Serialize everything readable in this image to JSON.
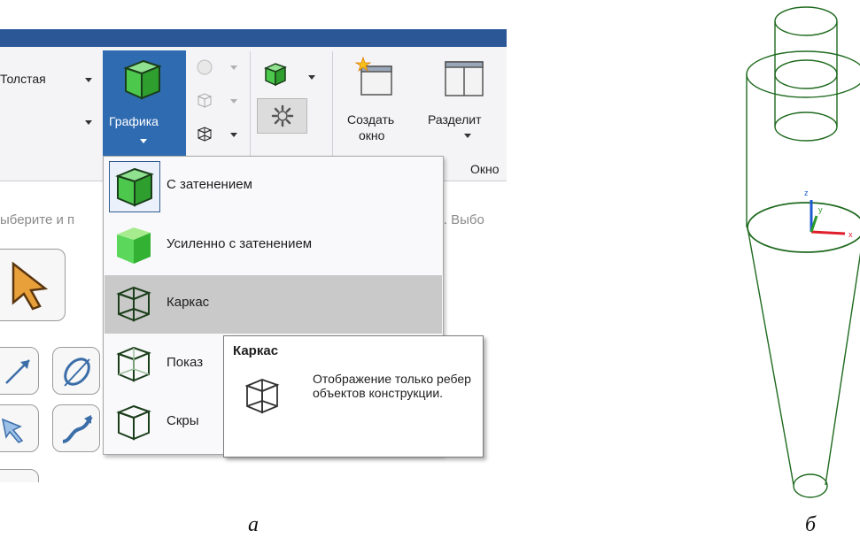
{
  "ribbon": {
    "line_label": "Толстая",
    "grafika_label": "Графика",
    "create_window_label_line1": "Создать",
    "create_window_label_line2": "окно",
    "split_label": "Разделит",
    "window_group_label": "Окно"
  },
  "status": {
    "prompt_left": "ыберите и п",
    "prompt_right": "ь. Выбо"
  },
  "dropdown": {
    "items": [
      {
        "label": "С затенением",
        "icon": "shaded-cube-icon"
      },
      {
        "label": "Усиленно с затенением",
        "icon": "enhanced-shaded-cube-icon"
      },
      {
        "label": "Каркас",
        "icon": "wireframe-cube-icon"
      },
      {
        "label": "Показ",
        "icon": "hidden-lines-visible-icon"
      },
      {
        "label": "Скры",
        "icon": "hidden-lines-removed-icon"
      }
    ]
  },
  "tooltip": {
    "title": "Каркас",
    "description": "Отображение только ребер объектов конструкции."
  },
  "model": {
    "axis_x": "x",
    "axis_y": "y",
    "axis_z": "z",
    "line_color": "#1f6a1f"
  },
  "captions": {
    "left": "а",
    "right": "б"
  },
  "colors": {
    "accent": "#2f6bb1",
    "titlebar": "#2b5797",
    "shaded_green": "#3fbf3f"
  }
}
